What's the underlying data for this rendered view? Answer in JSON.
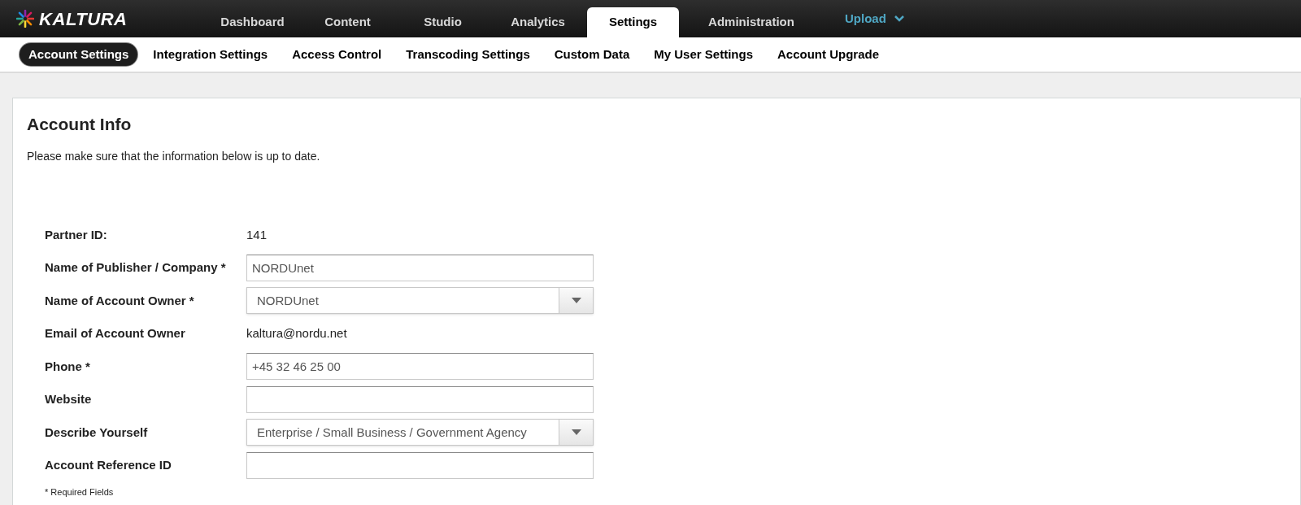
{
  "brand": "KALTURA",
  "main_nav": [
    {
      "label": "Dashboard",
      "selected": false,
      "kind": "tab"
    },
    {
      "label": "Content",
      "selected": false,
      "kind": "tab"
    },
    {
      "label": "Studio",
      "selected": false,
      "kind": "tab"
    },
    {
      "label": "Analytics",
      "selected": false,
      "kind": "tab"
    },
    {
      "label": "Settings",
      "selected": true,
      "kind": "tab"
    },
    {
      "label": "Administration",
      "selected": false,
      "kind": "tab"
    },
    {
      "label": "Upload",
      "selected": false,
      "kind": "menu"
    }
  ],
  "sub_nav": [
    {
      "label": "Account Settings",
      "selected": true
    },
    {
      "label": "Integration Settings",
      "selected": false
    },
    {
      "label": "Access Control",
      "selected": false
    },
    {
      "label": "Transcoding Settings",
      "selected": false
    },
    {
      "label": "Custom Data",
      "selected": false
    },
    {
      "label": "My User Settings",
      "selected": false
    },
    {
      "label": "Account Upgrade",
      "selected": false
    }
  ],
  "card": {
    "title": "Account Info",
    "intro": "Please make sure that the information below is up to date.",
    "fields": [
      {
        "label": "Partner ID:",
        "kind": "static",
        "value": "141"
      },
      {
        "label": "Name of Publisher / Company *",
        "kind": "input",
        "value": "NORDUnet"
      },
      {
        "label": "Name of Account Owner *",
        "kind": "select",
        "value": "NORDUnet"
      },
      {
        "label": "Email of Account Owner",
        "kind": "static",
        "value": "kaltura@nordu.net"
      },
      {
        "label": "Phone *",
        "kind": "input",
        "value": "+45 32 46 25 00"
      },
      {
        "label": "Website",
        "kind": "input"
      },
      {
        "label": "Describe Yourself",
        "kind": "select",
        "value": "Enterprise / Small Business / Government Agency"
      },
      {
        "label": "Account Reference ID",
        "kind": "input"
      }
    ],
    "footnote": "* Required Fields"
  }
}
